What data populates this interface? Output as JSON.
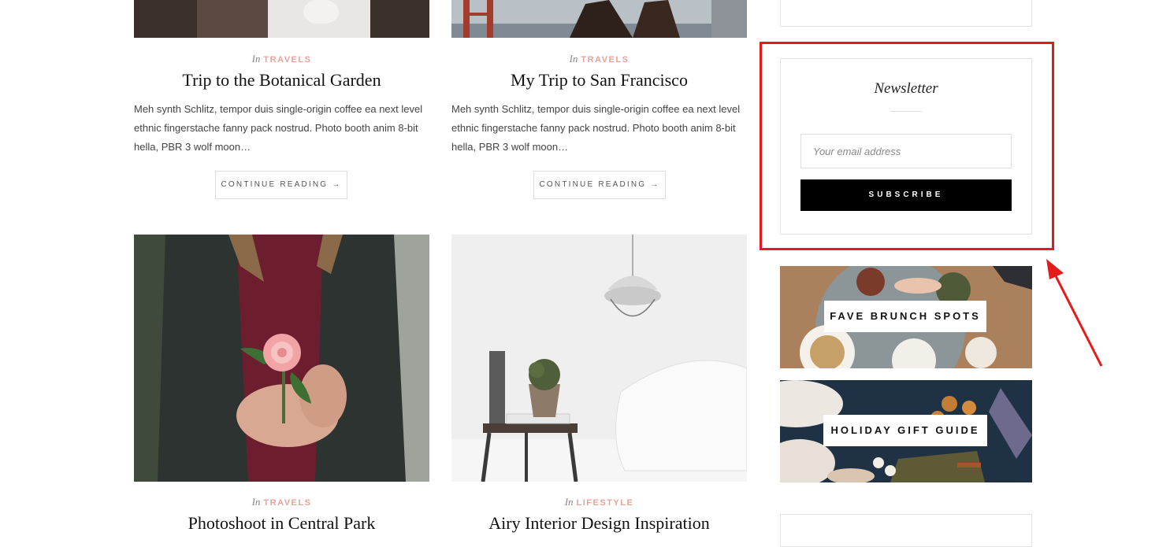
{
  "posts": [
    {
      "category_prefix": "In",
      "category": "TRAVELS",
      "title": "Trip to the Botanical Garden",
      "excerpt": "Meh synth Schlitz, tempor duis single-origin coffee ea next level ethnic fingerstache fanny pack nostrud. Photo booth anim 8-bit hella, PBR 3 wolf moon…",
      "button": "CONTINUE READING →"
    },
    {
      "category_prefix": "In",
      "category": "TRAVELS",
      "title": "My Trip to San Francisco",
      "excerpt": "Meh synth Schlitz, tempor duis single-origin coffee ea next level ethnic fingerstache fanny pack nostrud. Photo booth anim 8-bit hella, PBR 3 wolf moon…",
      "button": "CONTINUE READING →"
    },
    {
      "category_prefix": "In",
      "category": "TRAVELS",
      "title": "Photoshoot in Central Park"
    },
    {
      "category_prefix": "In",
      "category": "LIFESTYLE",
      "title": "Airy Interior Design Inspiration"
    }
  ],
  "newsletter": {
    "title": "Newsletter",
    "email_placeholder": "Your email address",
    "subscribe_label": "SUBSCRIBE"
  },
  "promos": [
    {
      "label": "FAVE BRUNCH SPOTS"
    },
    {
      "label": "HOLIDAY GIFT GUIDE"
    }
  ],
  "colors": {
    "accent": "#e5a39a",
    "highlight": "#e31b1b",
    "button_bg": "#000000"
  }
}
